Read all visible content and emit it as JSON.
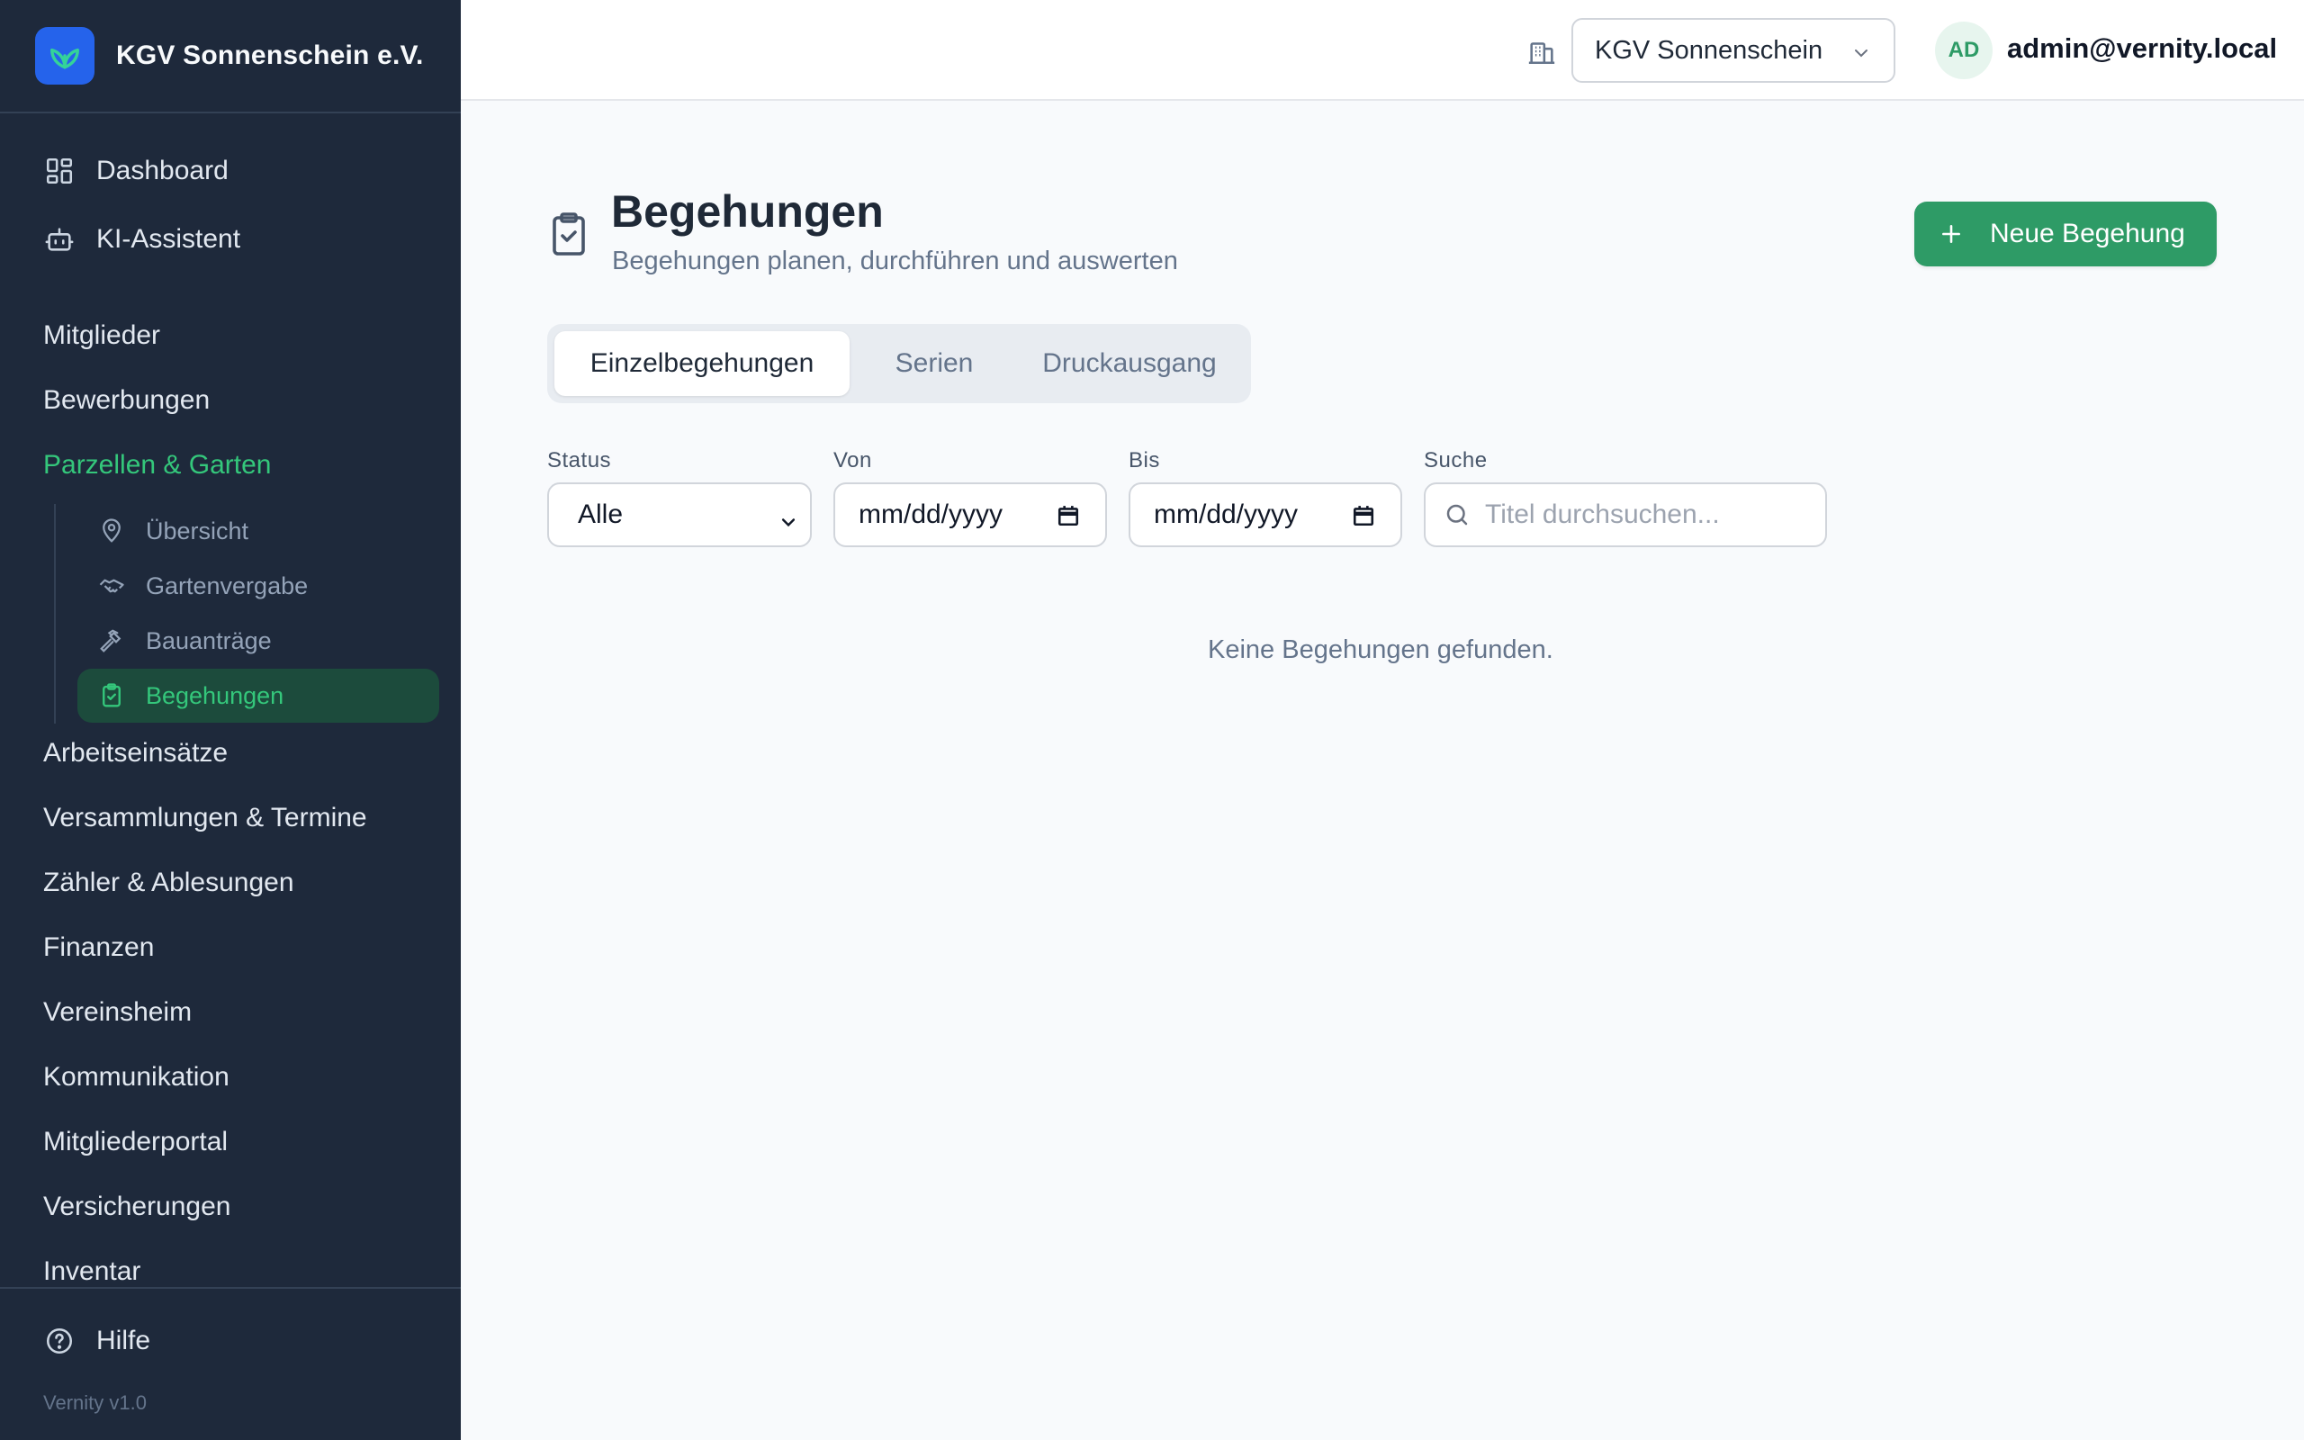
{
  "app": {
    "org_name": "KGV Sonnenschein e.V.",
    "version": "Vernity v1.0"
  },
  "sidebar": {
    "top_items": [
      {
        "label": "Dashboard",
        "icon": "layout-dashboard-icon"
      },
      {
        "label": "KI-Assistent",
        "icon": "bot-icon"
      }
    ],
    "sections": [
      {
        "label": "Mitglieder"
      },
      {
        "label": "Bewerbungen"
      },
      {
        "label": "Parzellen & Garten",
        "active": true
      },
      {
        "label": "Arbeitseinsätze"
      },
      {
        "label": "Versammlungen & Termine"
      },
      {
        "label": "Zähler & Ablesungen"
      },
      {
        "label": "Finanzen"
      },
      {
        "label": "Vereinsheim"
      },
      {
        "label": "Kommunikation"
      },
      {
        "label": "Mitgliederportal"
      },
      {
        "label": "Versicherungen"
      },
      {
        "label": "Inventar"
      }
    ],
    "sub_items": [
      {
        "label": "Übersicht",
        "icon": "map-pin-icon"
      },
      {
        "label": "Gartenvergabe",
        "icon": "handshake-icon"
      },
      {
        "label": "Bauanträge",
        "icon": "hammer-icon"
      },
      {
        "label": "Begehungen",
        "icon": "clipboard-check-icon",
        "active": true
      }
    ],
    "help_label": "Hilfe"
  },
  "header": {
    "org_select_value": "KGV Sonnenschein e.V.",
    "avatar_initials": "AD",
    "user_email": "admin@vernity.local"
  },
  "page": {
    "title": "Begehungen",
    "subtitle": "Begehungen planen, durchführen und auswerten",
    "new_button": "Neue Begehung"
  },
  "tabs": [
    {
      "label": "Einzelbegehungen",
      "active": true
    },
    {
      "label": "Serien"
    },
    {
      "label": "Druckausgang"
    }
  ],
  "filters": {
    "status_label": "Status",
    "status_value": "Alle",
    "from_label": "Von",
    "from_value": "mm/dd/yyyy",
    "to_label": "Bis",
    "to_value": "mm/dd/yyyy",
    "search_label": "Suche",
    "search_placeholder": "Titel durchsuchen..."
  },
  "empty_message": "Keine Begehungen gefunden.",
  "colors": {
    "sidebar_bg": "#1e293b",
    "accent": "#2e9b66",
    "active_nav": "#34c77b",
    "brand_logo": "#2563eb"
  }
}
